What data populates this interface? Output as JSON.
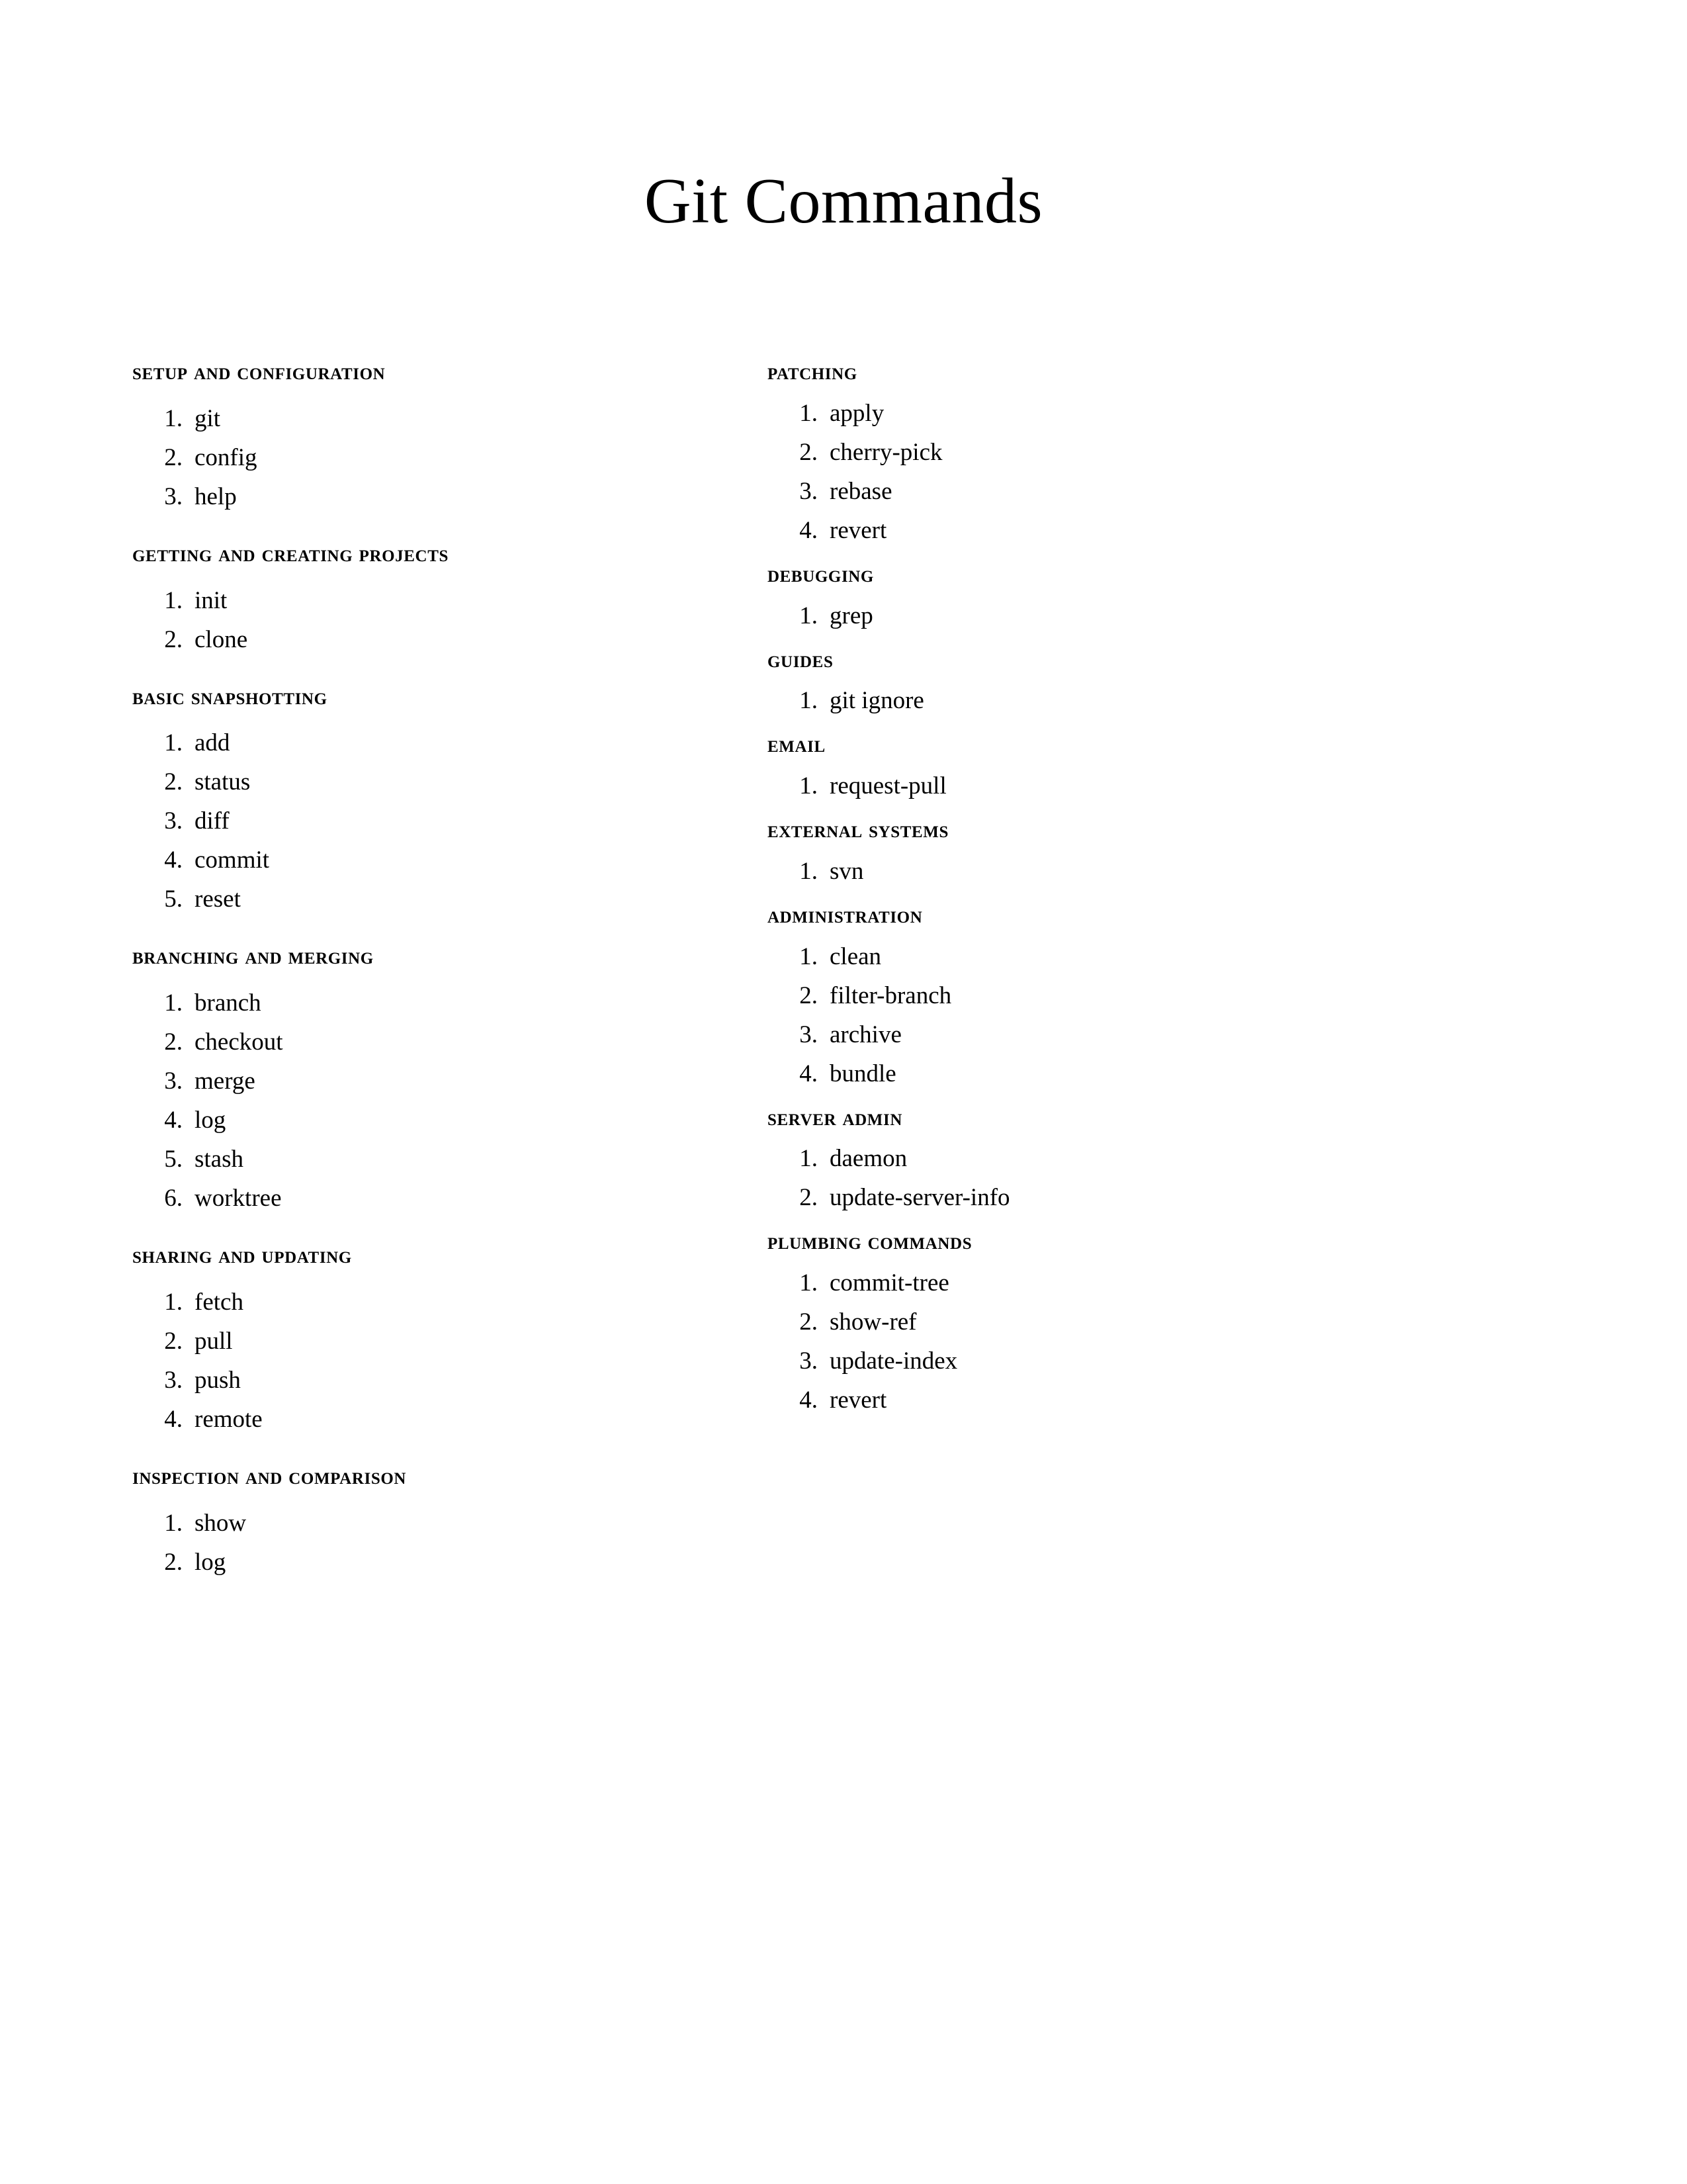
{
  "document": {
    "title": "Git Commands",
    "background_color": "#ffffff",
    "text_color": "#000000"
  },
  "columns": {
    "left": [
      {
        "heading": "Setup and Configuration",
        "items": [
          "git",
          "config",
          "help"
        ]
      },
      {
        "heading": "Getting and Creating Projects",
        "items": [
          "init",
          "clone"
        ]
      },
      {
        "heading": "Basic Snapshotting",
        "items": [
          "add",
          "status",
          "diff",
          "commit",
          "reset"
        ]
      },
      {
        "heading": "Branching and Merging",
        "items": [
          "branch",
          "checkout",
          "merge",
          "log",
          "stash",
          "worktree"
        ]
      },
      {
        "heading": "Sharing and Updating",
        "items": [
          "fetch",
          "pull",
          "push",
          "remote"
        ]
      },
      {
        "heading": "Inspection and Comparison",
        "items": [
          "show",
          "log"
        ]
      }
    ],
    "right": [
      {
        "heading": "Patching",
        "items": [
          "apply",
          "cherry-pick",
          "rebase",
          "revert"
        ]
      },
      {
        "heading": "Debugging",
        "items": [
          "grep"
        ]
      },
      {
        "heading": "Guides",
        "items": [
          "git ignore"
        ]
      },
      {
        "heading": "Email",
        "items": [
          "request-pull"
        ]
      },
      {
        "heading": "External Systems",
        "items": [
          "svn"
        ]
      },
      {
        "heading": "Administration",
        "items": [
          "clean",
          "filter-branch",
          "archive",
          "bundle"
        ]
      },
      {
        "heading": "Server Admin",
        "items": [
          "daemon",
          "update-server-info"
        ]
      },
      {
        "heading": "Plumbing Commands",
        "items": [
          "commit-tree",
          "show-ref",
          "update-index",
          "revert"
        ]
      }
    ]
  }
}
